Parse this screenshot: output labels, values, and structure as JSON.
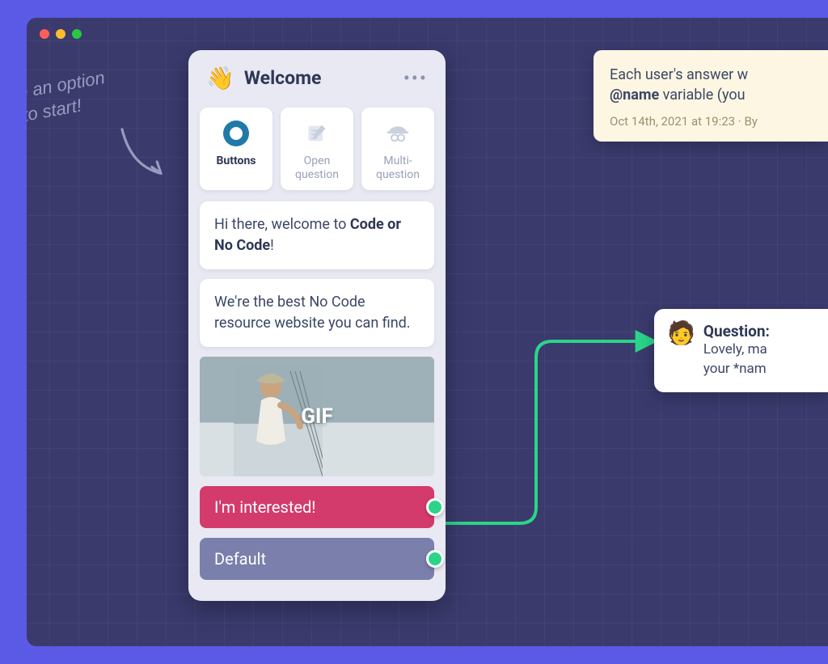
{
  "hint": {
    "text": "se an option\n  to start!"
  },
  "welcome": {
    "title": "Welcome",
    "tabs": {
      "buttons": "Buttons",
      "open": "Open question",
      "multi": "Multi-question"
    },
    "msg1_pre": "Hi there, welcome to ",
    "msg1_bold": "Code or No Code",
    "msg1_post": "!",
    "msg2": "We're the best No Code resource website you can find.",
    "gif_label": "GIF",
    "choice1": "I'm interested!",
    "choice2": "Default"
  },
  "note": {
    "line1_pre": "Each user's answer w",
    "line2_bold": "@name",
    "line2_post": " variable (you",
    "meta": "Oct 14th, 2021 at 19:23 · By "
  },
  "question": {
    "title": "Question:",
    "body_line1": "Lovely, ma",
    "body_line2": "your *nam"
  }
}
